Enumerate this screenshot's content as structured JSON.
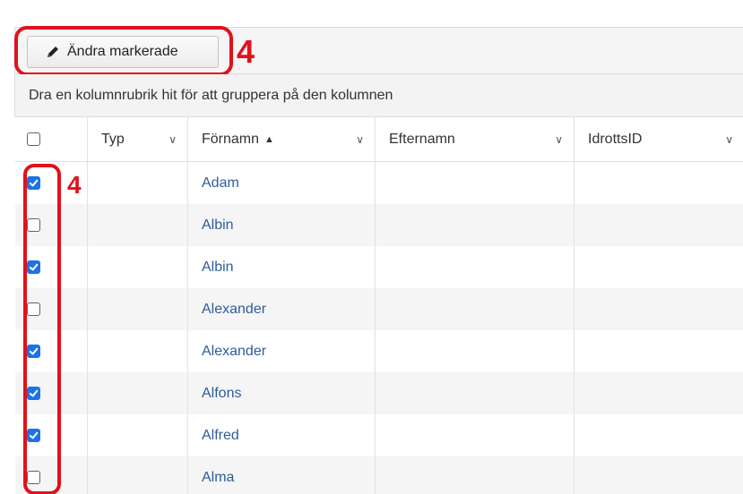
{
  "toolbar": {
    "edit_label": "Ändra markerade",
    "annotation_number": "4"
  },
  "group_hint": "Dra en kolumnrubrik hit för att gruppera på den kolumnen",
  "columns": [
    {
      "label": "",
      "type": "checkbox"
    },
    {
      "label": "Typ"
    },
    {
      "label": "Förnamn",
      "sort": "▲"
    },
    {
      "label": "Efternamn"
    },
    {
      "label": "IdrottsID"
    }
  ],
  "row_annotation_number": "4",
  "rows": [
    {
      "checked": true,
      "typ": "",
      "fornamn": "Adam",
      "efternamn": "",
      "idrottsid": ""
    },
    {
      "checked": false,
      "typ": "",
      "fornamn": "Albin",
      "efternamn": "",
      "idrottsid": ""
    },
    {
      "checked": true,
      "typ": "",
      "fornamn": "Albin",
      "efternamn": "",
      "idrottsid": ""
    },
    {
      "checked": false,
      "typ": "",
      "fornamn": "Alexander",
      "efternamn": "",
      "idrottsid": ""
    },
    {
      "checked": true,
      "typ": "",
      "fornamn": "Alexander",
      "efternamn": "",
      "idrottsid": ""
    },
    {
      "checked": true,
      "typ": "",
      "fornamn": "Alfons",
      "efternamn": "",
      "idrottsid": ""
    },
    {
      "checked": true,
      "typ": "",
      "fornamn": "Alfred",
      "efternamn": "",
      "idrottsid": ""
    },
    {
      "checked": false,
      "typ": "",
      "fornamn": "Alma",
      "efternamn": "",
      "idrottsid": ""
    }
  ],
  "colors": {
    "annotation": "#e0121b",
    "checkbox_checked": "#1a73e8",
    "link_text": "#2e5c99"
  },
  "icons": {
    "edit": "pencil-icon",
    "column_menu": "chevron-down-icon",
    "sort": "sort-ascending-icon"
  }
}
